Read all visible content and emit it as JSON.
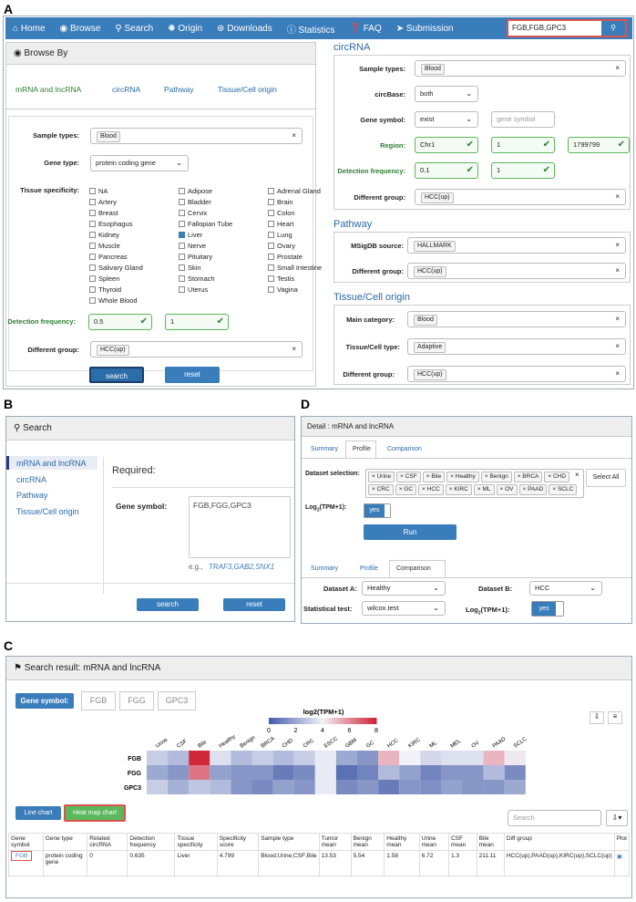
{
  "panels": {
    "a": "A",
    "b": "B",
    "c": "C",
    "d": "D"
  },
  "nav": {
    "items": [
      "Home",
      "Browse",
      "Search",
      "Origin",
      "Downloads",
      "Statistics",
      "FAQ",
      "Submission"
    ],
    "search_value": "FGB,FGB,GPC3"
  },
  "browse": {
    "title": "Browse By",
    "tabs": [
      "mRNA and lncRNA",
      "circRNA",
      "Pathway",
      "Tissue/Cell origin"
    ],
    "sample_types_label": "Sample types:",
    "sample_tag": "Blood",
    "gene_type_label": "Gene type:",
    "gene_type_value": "protein coding gene",
    "tissue_label": "Tissue specificity:",
    "tissues": [
      [
        "NA",
        "Adipose",
        "Adrenal Gland"
      ],
      [
        "Artery",
        "Bladder",
        "Brain"
      ],
      [
        "Breast",
        "Cervix",
        "Colon"
      ],
      [
        "Esophagus",
        "Fallopian Tube",
        "Heart"
      ],
      [
        "Kidney",
        "Liver",
        "Lung"
      ],
      [
        "Muscle",
        "Nerve",
        "Ovary"
      ],
      [
        "Pancreas",
        "Pituitary",
        "Prostate"
      ],
      [
        "Salivary Gland",
        "Skin",
        "Small Intestine"
      ],
      [
        "Spleen",
        "Stomach",
        "Testis"
      ],
      [
        "Thyroid",
        "Uterus",
        "Vagina"
      ],
      [
        "Whole Blood",
        "",
        ""
      ]
    ],
    "checked": "Liver",
    "det_label": "Detection frequency:",
    "det1": "0.5",
    "det2": "1",
    "diff_label": "Different group:",
    "diff_tag": "HCC(up)",
    "search_btn": "search",
    "reset_btn": "reset"
  },
  "circ": {
    "title": "circRNA",
    "sample_label": "Sample types:",
    "sample_tag": "Blood",
    "base_label": "circBase:",
    "base_value": "both",
    "gene_label": "Gene symbol:",
    "gene_value": "exist",
    "gene_ph": "gene symbol",
    "region_label": "Region:",
    "region1": "Chr1",
    "region2": "1",
    "region3": "1799799",
    "det_label": "Detection frequency:",
    "det1": "0.1",
    "det2": "1",
    "diff_label": "Different group:",
    "diff_tag": "HCC(up)"
  },
  "pathway": {
    "title": "Pathway",
    "msig_label": "MSigDB source:",
    "msig_tag": "HALLMARK",
    "diff_label": "Different group:",
    "diff_tag": "HCC(up)"
  },
  "tissue": {
    "title": "Tissue/Cell origin",
    "main_label": "Main category:",
    "main_tag": "Blood",
    "type_label": "Tissue/Cell type:",
    "type_tag": "Adaptive",
    "diff_label": "Different group:",
    "diff_tag": "HCC(up)"
  },
  "searchB": {
    "title": "Search",
    "menu": [
      "mRNA and lncRNA",
      "circRNA",
      "Pathway",
      "Tissue/Cell origin"
    ],
    "required": "Required:",
    "gene_label": "Gene symbol:",
    "gene_value": "FGB,FGG,GPC3",
    "eg_prefix": "e.g.,",
    "eg": "TRAF3,GAB2,SNX1",
    "search_btn": "search",
    "reset_btn": "reset"
  },
  "detail": {
    "title": "Detail : mRNA and lncRNA",
    "tabs": [
      "Summary",
      "Profile",
      "Comparison"
    ],
    "dataset_label": "Dataset selection:",
    "datasets": [
      "Urine",
      "CSF",
      "Bile",
      "Healthy",
      "Benign",
      "BRCA",
      "CHD",
      "CRC",
      "GC",
      "HCC",
      "KIRC",
      "ML",
      "OV",
      "PAAD",
      "SCLC"
    ],
    "select_all": "Select All",
    "log_label": "Log",
    "log_sub": "2",
    "log_rest": "(TPM+1):",
    "yes": "yes",
    "run": "Run",
    "dsa_label": "Dataset A:",
    "dsa_value": "Healthy",
    "dsb_label": "Dataset B:",
    "dsb_value": "HCC",
    "stat_label": "Statistical test:",
    "stat_value": "wilcox.test",
    "log2_label": "Log",
    "log2_rest": "(TPM+1):",
    "yes2": "yes"
  },
  "result": {
    "title": "Search result: mRNA and lncRNA",
    "gene_btn": "Gene symbol:",
    "genes": [
      "FGB",
      "FGG",
      "GPC3"
    ],
    "legend_title": "log2(TPM+1)",
    "legend_ticks": [
      "0",
      "2",
      "4",
      "6",
      "8"
    ],
    "line_btn": "Line chart",
    "heat_btn": "Heat map chart",
    "search_ph": "Search",
    "columns": [
      "Gene symbol",
      "Gene type",
      "Related circRNA",
      "Detection frequency",
      "Tissue specificity",
      "Specificity score",
      "Sample type",
      "Tumor mean",
      "Benign mean",
      "Healthy mean",
      "Urine mean",
      "CSF mean",
      "Bile mean",
      "Diff group",
      "Plot"
    ],
    "row": [
      "FGB",
      "protein coding gene",
      "0",
      "0.635",
      "Liver",
      "4.799",
      "Blood;Urine;CSF;Bile",
      "13.53",
      "5.54",
      "1.58",
      "6.72",
      "1.3",
      "211.11",
      "HCC(up),PAAD(up),KIRC(up),SCLC(up)",
      ""
    ]
  },
  "chart_data": {
    "type": "heatmap",
    "x": [
      "Urine",
      "CSF",
      "Bile",
      "Healthy",
      "Benign",
      "BRCA",
      "CHD",
      "CRC",
      "ESCC",
      "GBM",
      "GC",
      "HCC",
      "KIRC",
      "ML",
      "MEL",
      "OV",
      "PAAD",
      "SCLC"
    ],
    "y": [
      "FGB",
      "FGG",
      "GPC3"
    ],
    "colorbar_label": "log2(TPM+1)",
    "range": [
      0,
      8
    ],
    "values": [
      [
        3,
        2.5,
        8,
        3.5,
        2.5,
        3,
        2.5,
        3,
        3.8,
        2,
        1.5,
        5.2,
        4,
        3.3,
        3.5,
        3.5,
        5.2,
        4.2
      ],
      [
        2,
        1.5,
        6.5,
        1.8,
        1.5,
        1.5,
        0.8,
        1.2,
        3.8,
        0.5,
        1,
        2.5,
        1.8,
        1,
        1.5,
        1.5,
        2.5,
        1.2
      ],
      [
        3,
        2.2,
        2.8,
        2.5,
        1.5,
        1.2,
        1.8,
        1.5,
        3.8,
        1.2,
        1.5,
        0.8,
        1.5,
        1.3,
        1.8,
        1.5,
        1.5,
        2
      ]
    ]
  }
}
